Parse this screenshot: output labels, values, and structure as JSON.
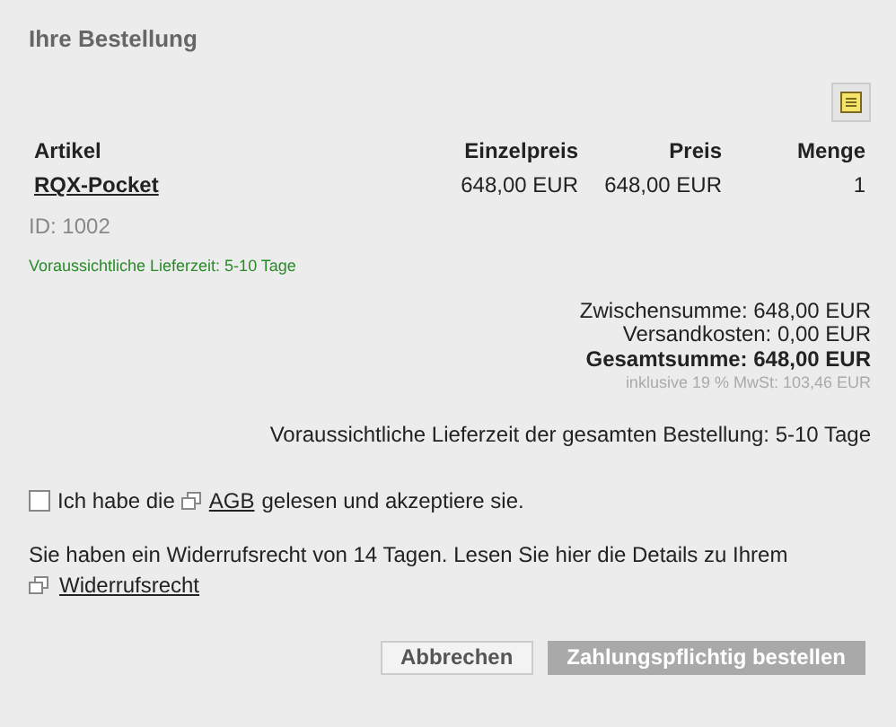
{
  "title": "Ihre Bestellung",
  "table": {
    "columns": [
      "Artikel",
      "Einzelpreis",
      "Preis",
      "Menge"
    ],
    "rows": [
      {
        "article": "RQX-Pocket",
        "unit_price": "648,00 EUR",
        "price": "648,00 EUR",
        "quantity": "1",
        "id": "ID: 1002",
        "delivery": "Voraussichtliche Lieferzeit: 5-10 Tage"
      }
    ]
  },
  "totals": {
    "subtotal": "Zwischensumme: 648,00 EUR",
    "shipping": "Versandkosten: 0,00 EUR",
    "total": "Gesamtsumme: 648,00 EUR",
    "tax": "inklusive 19 % MwSt: 103,46 EUR"
  },
  "delivery_total": "Voraussichtliche Lieferzeit der gesamten Bestellung: 5-10 Tage",
  "agreement": {
    "checked": false,
    "before": "Ich habe die",
    "link": "AGB",
    "after": "gelesen und akzeptiere sie."
  },
  "withdrawal": {
    "text": "Sie haben ein Widerrufsrecht von 14 Tagen. Lesen Sie hier die Details zu Ihrem",
    "link": "Widerrufsrecht"
  },
  "buttons": [
    {
      "label": "Abbrechen",
      "disabled": false
    },
    {
      "label": "Zahlungspflichtig bestellen",
      "disabled": true
    }
  ]
}
